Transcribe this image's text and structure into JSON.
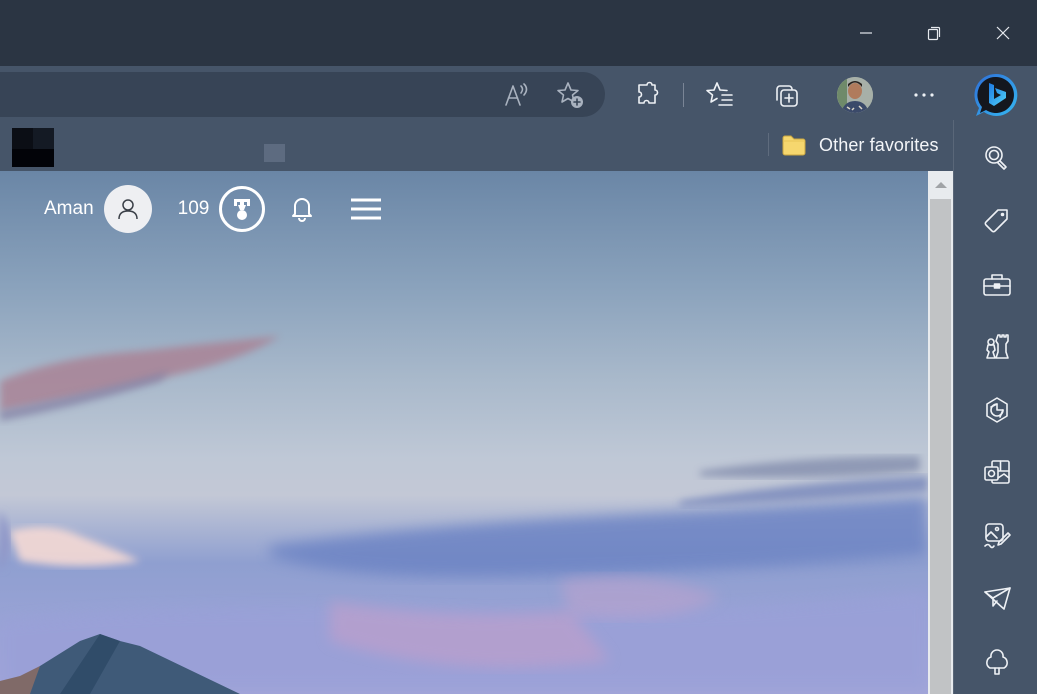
{
  "window": {
    "controls": [
      "minimize",
      "restore",
      "close"
    ]
  },
  "toolbar": {
    "address_icons": [
      {
        "name": "read-aloud-icon",
        "tooltip": "Read aloud"
      },
      {
        "name": "add-favorite-icon",
        "tooltip": "Add this page to favorites"
      }
    ],
    "icons": [
      {
        "name": "extensions-icon"
      },
      {
        "name": "favorites-icon"
      },
      {
        "name": "collections-icon"
      },
      {
        "name": "profile-avatar"
      },
      {
        "name": "more-options-icon"
      },
      {
        "name": "bing-chat-icon"
      }
    ]
  },
  "favorites_bar": {
    "other_favorites_label": "Other favorites",
    "folder_color": "#f6d76e"
  },
  "sidebar": {
    "items": [
      {
        "name": "search-icon"
      },
      {
        "name": "shopping-tag-icon"
      },
      {
        "name": "tools-icon"
      },
      {
        "name": "games-icon"
      },
      {
        "name": "microsoft-365-icon"
      },
      {
        "name": "outlook-icon"
      },
      {
        "name": "image-creator-icon"
      },
      {
        "name": "drop-icon"
      },
      {
        "name": "e-tree-icon"
      }
    ]
  },
  "page": {
    "user_name": "Aman",
    "rewards_points": "109"
  },
  "colors": {
    "titlebar": "#2b3543",
    "toolbar": "#465569",
    "address_bar": "#374456",
    "bing_blue": "#2b8ae6"
  }
}
